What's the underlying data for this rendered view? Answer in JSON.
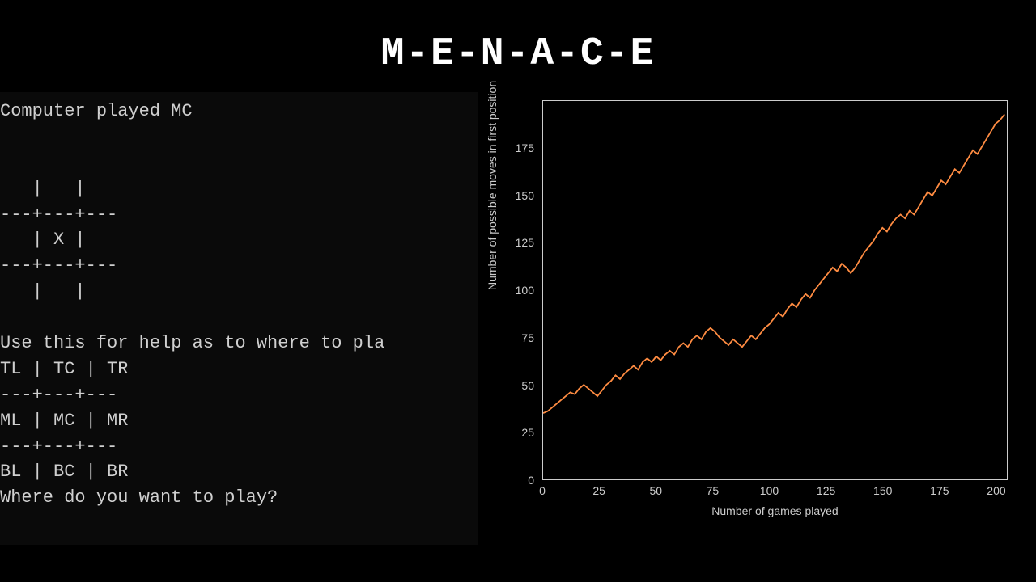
{
  "title": "M-E-N-A-C-E",
  "terminal": {
    "status_line": "Computer played MC",
    "board_row1": "   |   |",
    "board_sep": "---+---+---",
    "board_row2": "   | X |",
    "board_row3": "   |   |",
    "help_intro": "Use this for help as to where to pla",
    "help_row1": "TL | TC | TR",
    "help_sep": "---+---+---",
    "help_row2": "ML | MC | MR",
    "help_row3": "BL | BC | BR",
    "prompt": "Where do you want to play?"
  },
  "chart_data": {
    "type": "line",
    "xlabel": "Number of games played",
    "ylabel": "Number of possible moves in first position",
    "xlim": [
      0,
      205
    ],
    "ylim": [
      0,
      200
    ],
    "y_ticks": [
      0,
      25,
      50,
      75,
      100,
      125,
      150,
      175
    ],
    "x_ticks": [
      0,
      25,
      50,
      75,
      100,
      125,
      150,
      175,
      200
    ],
    "line_color": "#ff8c42",
    "x": [
      0,
      2,
      4,
      6,
      8,
      10,
      12,
      14,
      16,
      18,
      20,
      22,
      24,
      26,
      28,
      30,
      32,
      34,
      36,
      38,
      40,
      42,
      44,
      46,
      48,
      50,
      52,
      54,
      56,
      58,
      60,
      62,
      64,
      66,
      68,
      70,
      72,
      74,
      76,
      78,
      80,
      82,
      84,
      86,
      88,
      90,
      92,
      94,
      96,
      98,
      100,
      102,
      104,
      106,
      108,
      110,
      112,
      114,
      116,
      118,
      120,
      122,
      124,
      126,
      128,
      130,
      132,
      134,
      136,
      138,
      140,
      142,
      144,
      146,
      148,
      150,
      152,
      154,
      156,
      158,
      160,
      162,
      164,
      166,
      168,
      170,
      172,
      174,
      176,
      178,
      180,
      182,
      184,
      186,
      188,
      190,
      192,
      194,
      196,
      198,
      200,
      202,
      204
    ],
    "values": [
      35,
      36,
      38,
      40,
      42,
      44,
      46,
      45,
      48,
      50,
      48,
      46,
      44,
      47,
      50,
      52,
      55,
      53,
      56,
      58,
      60,
      58,
      62,
      64,
      62,
      65,
      63,
      66,
      68,
      66,
      70,
      72,
      70,
      74,
      76,
      74,
      78,
      80,
      78,
      75,
      73,
      71,
      74,
      72,
      70,
      73,
      76,
      74,
      77,
      80,
      82,
      85,
      88,
      86,
      90,
      93,
      91,
      95,
      98,
      96,
      100,
      103,
      106,
      109,
      112,
      110,
      114,
      112,
      109,
      112,
      116,
      120,
      123,
      126,
      130,
      133,
      131,
      135,
      138,
      140,
      138,
      142,
      140,
      144,
      148,
      152,
      150,
      154,
      158,
      156,
      160,
      164,
      162,
      166,
      170,
      174,
      172,
      176,
      180,
      184,
      188,
      190,
      193
    ]
  }
}
